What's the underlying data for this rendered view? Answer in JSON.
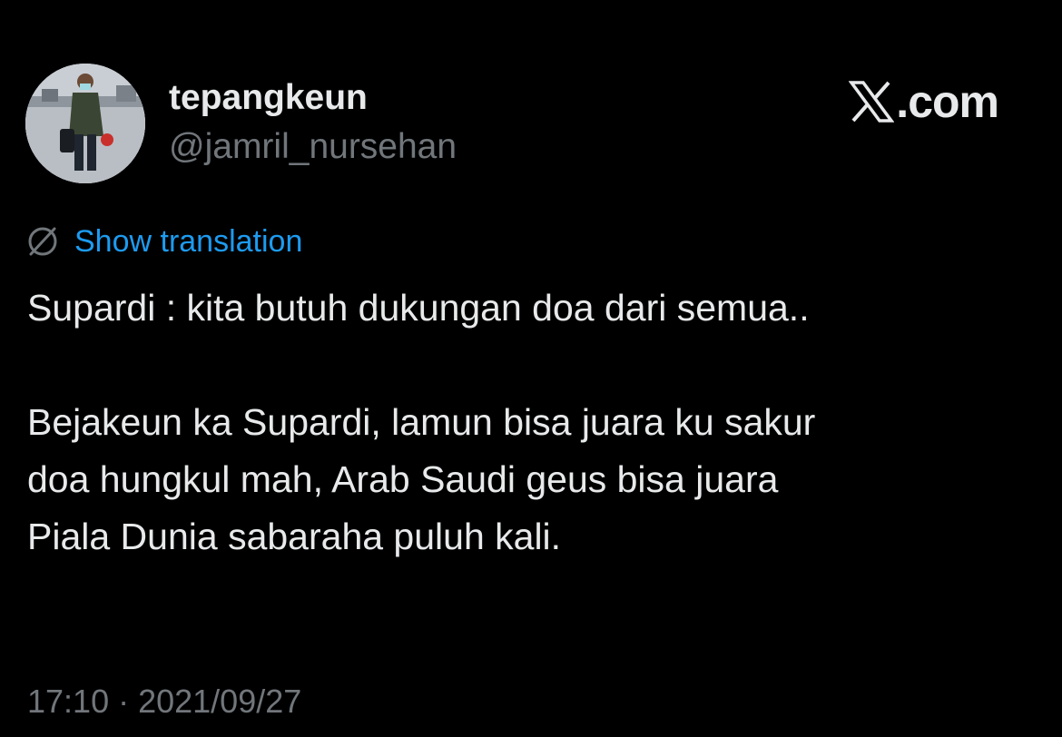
{
  "author": {
    "display_name": "tepangkeun",
    "handle": "@jamril_nursehan"
  },
  "brand": {
    "logo_icon": "x-logo-icon",
    "text": ".com"
  },
  "translation": {
    "icon": "globe-slash-icon",
    "label": "Show translation"
  },
  "tweet": {
    "line1": "Supardi : kita butuh dukungan doa dari semua..",
    "paragraph2": [
      "Bejakeun ka Supardi, lamun bisa juara ku sakur",
      "doa hungkul mah, Arab Saudi geus bisa juara",
      "Piala Dunia sabaraha puluh kali."
    ]
  },
  "timestamp": "17:10 · 2021/09/27",
  "colors": {
    "background": "#000000",
    "text": "#e7e9ea",
    "secondary": "#71767b",
    "link": "#1d9bf0"
  }
}
